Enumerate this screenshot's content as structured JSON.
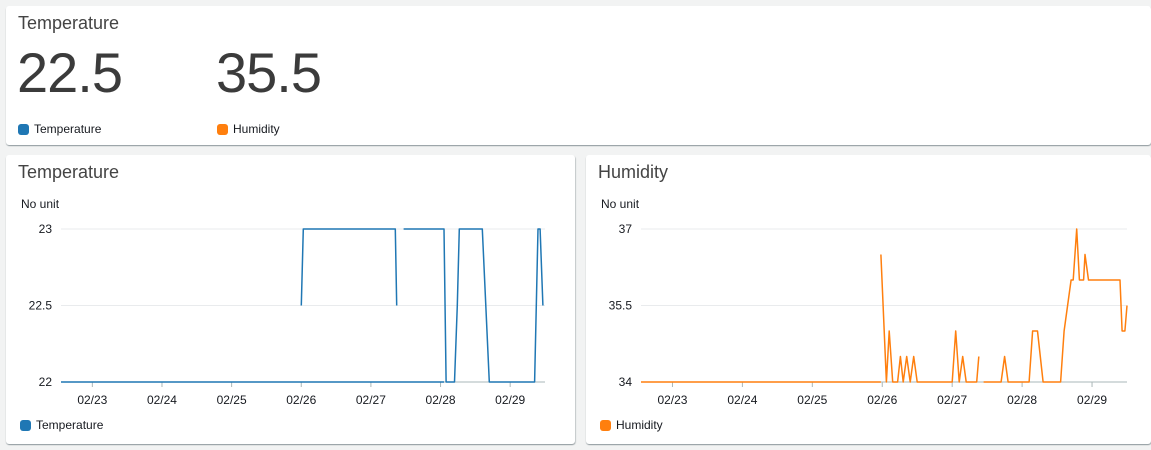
{
  "top": {
    "title": "Temperature",
    "values": [
      {
        "value": "22.5",
        "label": "Temperature",
        "color": "#1f77b4"
      },
      {
        "value": "35.5",
        "label": "Humidity",
        "color": "#ff7f0e"
      }
    ]
  },
  "temperature_panel": {
    "title": "Temperature",
    "unit": "No unit",
    "legend": "Temperature",
    "color": "#1f77b4"
  },
  "humidity_panel": {
    "title": "Humidity",
    "unit": "No unit",
    "legend": "Humidity",
    "color": "#ff7f0e"
  },
  "chart_data": [
    {
      "type": "line",
      "title": "Temperature",
      "ylabel": "No unit",
      "x_ticks": [
        1,
        2,
        3,
        4,
        5,
        6,
        7
      ],
      "x_tick_labels": [
        "02/23",
        "02/24",
        "02/25",
        "02/26",
        "02/27",
        "02/28",
        "02/29"
      ],
      "y_ticks": [
        22,
        22.5,
        23
      ],
      "ylim": [
        22,
        23
      ],
      "xlim": [
        0.55,
        7.5
      ],
      "grid": true,
      "series": [
        {
          "name": "Temperature",
          "color": "#1f77b4",
          "segments": [
            [
              [
                0.55,
                22
              ],
              [
                6.05,
                22
              ],
              [
                6.05,
                22
              ]
            ],
            [
              [
                4.0,
                22.5
              ],
              [
                4.03,
                23
              ],
              [
                5.35,
                23
              ],
              [
                5.37,
                22.5
              ]
            ],
            [
              [
                5.47,
                23
              ],
              [
                6.05,
                23
              ],
              [
                6.08,
                22
              ],
              [
                6.2,
                22
              ],
              [
                6.24,
                22.5
              ],
              [
                6.27,
                23
              ],
              [
                6.6,
                23
              ],
              [
                6.7,
                22
              ],
              [
                7.35,
                22
              ],
              [
                7.4,
                23
              ],
              [
                7.43,
                23
              ],
              [
                7.47,
                22.5
              ]
            ]
          ]
        }
      ]
    },
    {
      "type": "line",
      "title": "Humidity",
      "ylabel": "No unit",
      "x_ticks": [
        1,
        2,
        3,
        4,
        5,
        6,
        7
      ],
      "x_tick_labels": [
        "02/23",
        "02/24",
        "02/25",
        "02/26",
        "02/27",
        "02/28",
        "02/29"
      ],
      "y_ticks": [
        34,
        35.5,
        37
      ],
      "ylim": [
        34,
        37
      ],
      "xlim": [
        0.55,
        7.5
      ],
      "grid": true,
      "series": [
        {
          "name": "Humidity",
          "color": "#ff7f0e",
          "segments": [
            [
              [
                0.55,
                34
              ],
              [
                3.98,
                34
              ]
            ],
            [
              [
                3.98,
                36.5
              ],
              [
                4.06,
                34
              ],
              [
                4.1,
                35
              ],
              [
                4.15,
                34
              ],
              [
                4.22,
                34
              ],
              [
                4.26,
                34.5
              ],
              [
                4.3,
                34
              ],
              [
                4.35,
                34.5
              ],
              [
                4.4,
                34
              ],
              [
                4.45,
                34.5
              ],
              [
                4.5,
                34
              ],
              [
                5.0,
                34
              ],
              [
                5.05,
                35
              ],
              [
                5.1,
                34
              ],
              [
                5.15,
                34.5
              ],
              [
                5.2,
                34
              ],
              [
                5.35,
                34
              ],
              [
                5.38,
                34.5
              ]
            ],
            [
              [
                5.45,
                34
              ],
              [
                5.7,
                34
              ],
              [
                5.75,
                34.5
              ],
              [
                5.8,
                34
              ],
              [
                6.1,
                34
              ],
              [
                6.15,
                35
              ],
              [
                6.22,
                35
              ],
              [
                6.3,
                34
              ],
              [
                6.55,
                34
              ],
              [
                6.6,
                35
              ],
              [
                6.7,
                36
              ],
              [
                6.73,
                36
              ],
              [
                6.78,
                37
              ],
              [
                6.82,
                36
              ],
              [
                6.88,
                36
              ],
              [
                6.9,
                36.5
              ],
              [
                6.95,
                36
              ],
              [
                7.4,
                36
              ],
              [
                7.43,
                35
              ],
              [
                7.47,
                35
              ],
              [
                7.5,
                35.5
              ]
            ]
          ]
        }
      ]
    }
  ]
}
